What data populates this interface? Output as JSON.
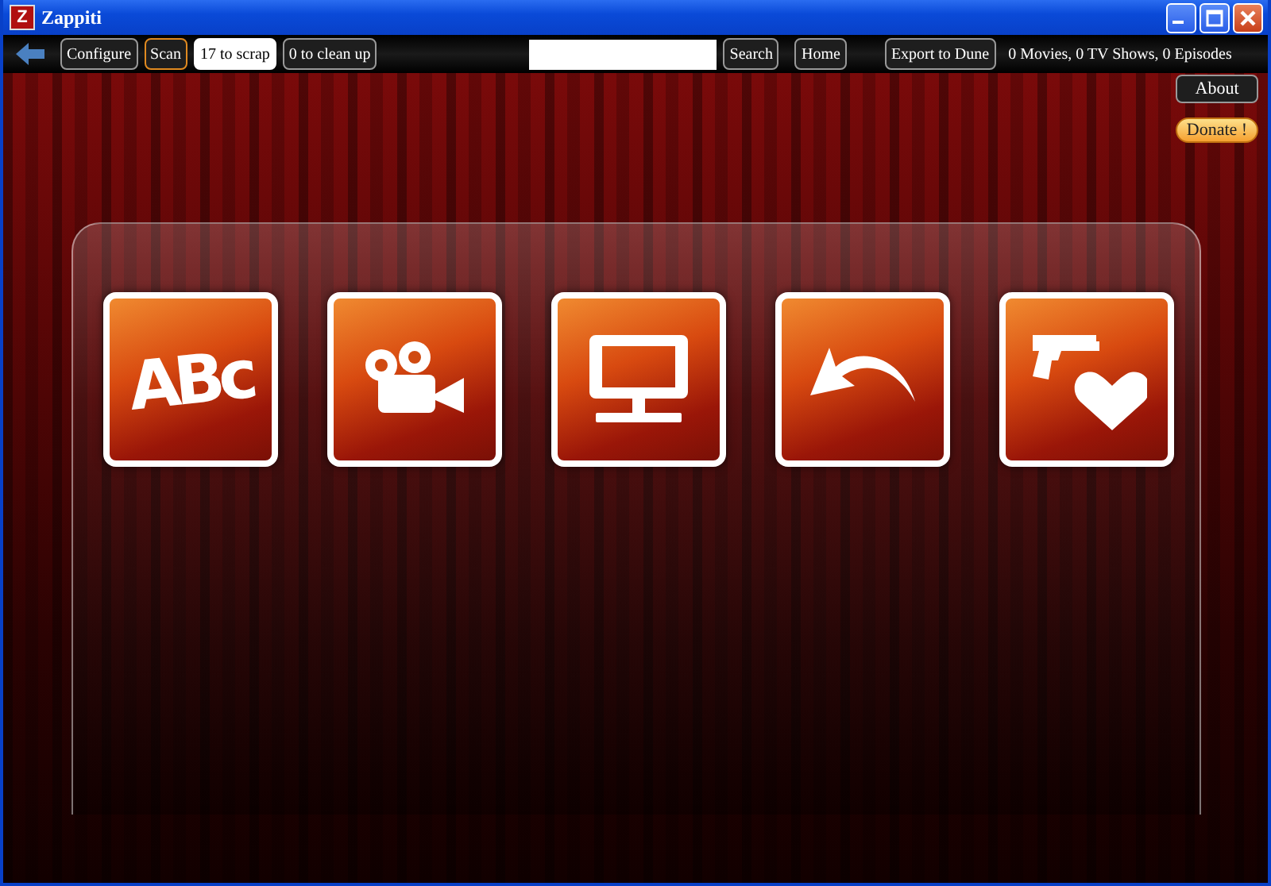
{
  "window": {
    "title": "Zappiti",
    "app_icon": "Z"
  },
  "toolbar": {
    "items": [
      {
        "kind": "back"
      },
      {
        "kind": "button",
        "label": "Configure",
        "highlighted": false
      },
      {
        "kind": "button",
        "label": "Scan",
        "highlighted": true
      },
      {
        "kind": "count",
        "label": "17 to scrap"
      },
      {
        "kind": "button",
        "label": "0 to clean up",
        "highlighted": false
      },
      {
        "kind": "search"
      },
      {
        "kind": "button",
        "label": "Search",
        "highlighted": false
      },
      {
        "kind": "button",
        "label": "Home",
        "highlighted": false
      },
      {
        "kind": "button",
        "label": "Export to Dune",
        "highlighted": false
      }
    ],
    "stats": "0 Movies, 0 TV Shows, 0 Episodes"
  },
  "side_buttons": [
    {
      "kind": "about",
      "label": "About"
    },
    {
      "kind": "donate",
      "label": "Donate !"
    }
  ],
  "tiles": [
    {
      "kind": "abc",
      "glyph": "ABc"
    },
    {
      "kind": "movie-camera"
    },
    {
      "kind": "monitor"
    },
    {
      "kind": "back-arrow"
    },
    {
      "kind": "gun-heart"
    }
  ]
}
